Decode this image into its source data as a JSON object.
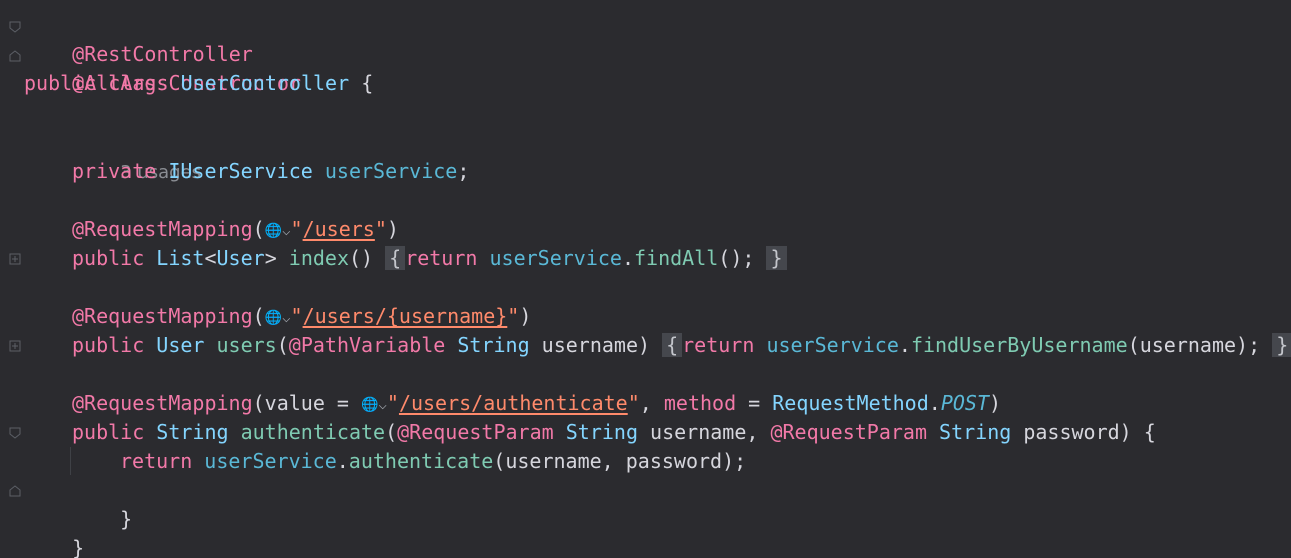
{
  "editor": {
    "line1": {
      "annotation": "@RestController"
    },
    "line2": {
      "annotation": "@AllArgsConstructor"
    },
    "line3": {
      "public_kw": "public",
      "class_kw": "class",
      "class_name": "UserController",
      "brace": "{"
    },
    "line4": {
      "usages": "3 usages"
    },
    "line5": {
      "private_kw": "private",
      "type": "IUserService",
      "field": "userService",
      "semi": ";"
    },
    "line6": {
      "annotation": "@RequestMapping",
      "open": "(",
      "quote_open": "\"",
      "path": "/users",
      "quote_close": "\"",
      "close": ")"
    },
    "line7": {
      "public_kw": "public",
      "list_type": "List",
      "lt": "<",
      "user_type": "User",
      "gt": ">",
      "method": "index",
      "parens": "()",
      "fold_open": "{",
      "return_kw": "return",
      "field": "userService",
      "dot": ".",
      "call": "findAll",
      "call_parens": "();",
      "fold_close": "}"
    },
    "line8": {
      "annotation": "@RequestMapping",
      "open": "(",
      "quote_open": "\"",
      "path": "/users/{username}",
      "quote_close": "\"",
      "close": ")"
    },
    "line9": {
      "public_kw": "public",
      "user_type": "User",
      "method": "users",
      "open": "(",
      "path_ann": "@PathVariable",
      "string_type": "String",
      "param": "username",
      "close": ")",
      "fold_open": "{",
      "return_kw": "return",
      "field": "userService",
      "dot": ".",
      "call": "findUserByUsername",
      "args": "(username);",
      "fold_close": "}"
    },
    "line10": {
      "annotation": "@RequestMapping",
      "open": "(",
      "value_kw": "value",
      "eq1": " = ",
      "quote_open": "\"",
      "path": "/users/authenticate",
      "quote_close": "\"",
      "comma": ", ",
      "method_kw": "method",
      "eq2": " = ",
      "enum_type": "RequestMethod",
      "dot": ".",
      "enum_const": "POST",
      "close": ")"
    },
    "line11": {
      "public_kw": "public",
      "string_type": "String",
      "method": "authenticate",
      "open": "(",
      "param_ann1": "@RequestParam",
      "string_type1": "String",
      "param1": "username",
      "comma": ", ",
      "param_ann2": "@RequestParam",
      "string_type2": "String",
      "param2": "password",
      "close": ")",
      "brace": "{"
    },
    "line12": {
      "return_kw": "return",
      "field": "userService",
      "dot": ".",
      "call": "authenticate",
      "args": "(username, password);"
    },
    "line13": {
      "brace": "}"
    },
    "line14": {
      "brace": "}"
    }
  },
  "icons": {
    "web_endpoint": "globe-icon",
    "fold": "fold-marker-icon"
  }
}
